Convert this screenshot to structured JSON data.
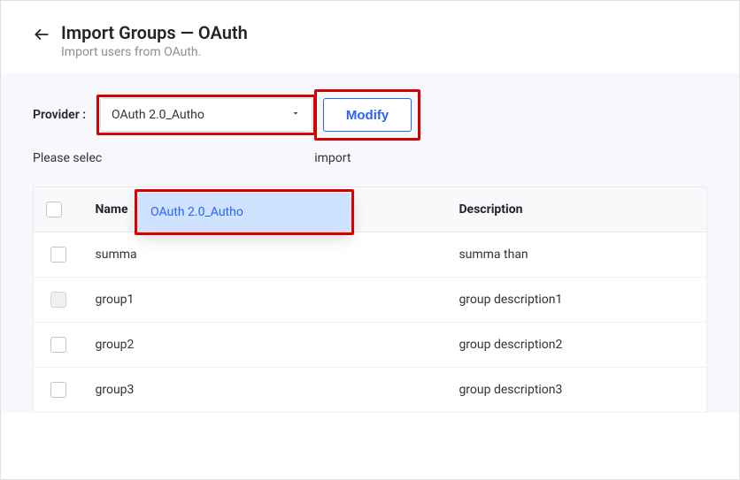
{
  "header": {
    "title": "Import Groups — OAuth",
    "subtitle": "Import users from OAuth."
  },
  "controls": {
    "provider_label": "Provider :",
    "selected_provider": "OAuth 2.0_Autho",
    "modify_label": "Modify",
    "dropdown_option": "OAuth 2.0_Autho",
    "instruction_prefix": "Please selec",
    "instruction_suffix": " import"
  },
  "table": {
    "headers": {
      "name": "Name",
      "description": "Description"
    },
    "rows": [
      {
        "name": "summa",
        "description": "summa than",
        "disabled": false
      },
      {
        "name": "group1",
        "description": "group description1",
        "disabled": true
      },
      {
        "name": "group2",
        "description": "group description2",
        "disabled": false
      },
      {
        "name": "group3",
        "description": "group description3",
        "disabled": false
      }
    ]
  }
}
